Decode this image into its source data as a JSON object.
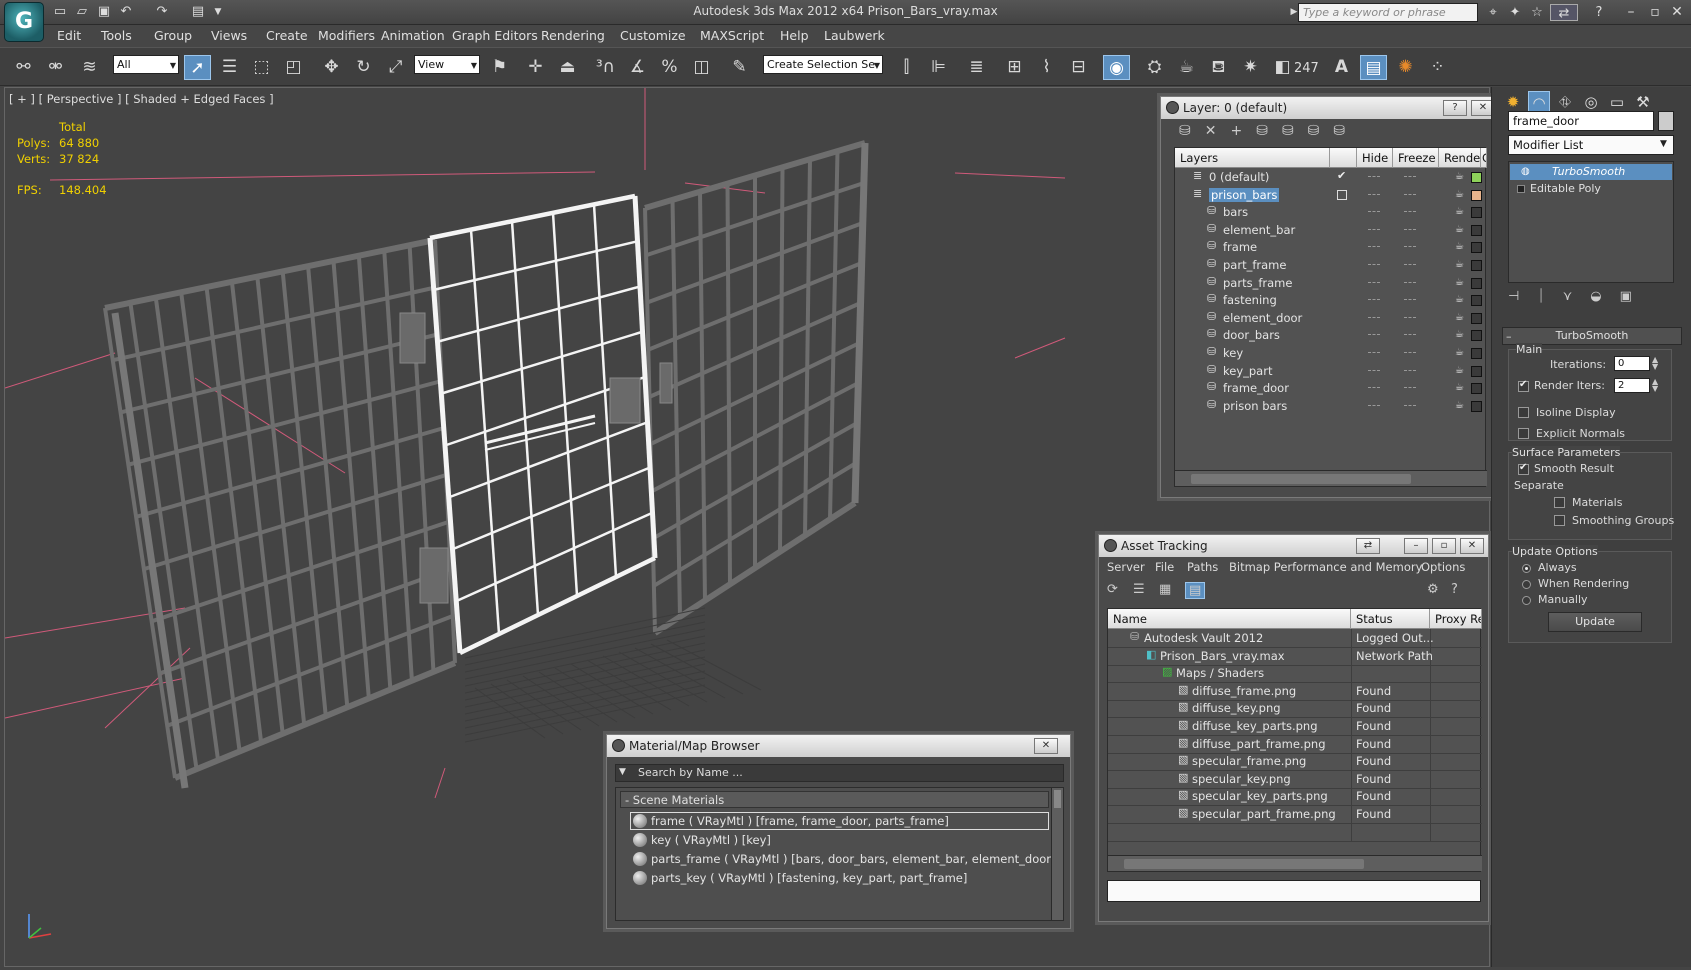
{
  "window": {
    "title": "Autodesk 3ds Max  2012 x64      Prison_Bars_vray.max",
    "search_placeholder": "Type a keyword or phrase"
  },
  "menu": [
    "Edit",
    "Tools",
    "Group",
    "Views",
    "Create",
    "Modifiers",
    "Animation",
    "Graph Editors",
    "Rendering",
    "Customize",
    "MAXScript",
    "Help",
    "Laubwerk"
  ],
  "toolbar": {
    "selection_filter": "All",
    "ref_coord": "View",
    "named_selection": "Create Selection Se",
    "counter": "247"
  },
  "viewport": {
    "label": "[ + ] [ Perspective ] [ Shaded + Edged Faces ]",
    "stats": {
      "total_label": "Total",
      "polys_label": "Polys:",
      "polys_value": "64 880",
      "verts_label": "Verts:",
      "verts_value": "37 824",
      "fps_label": "FPS:",
      "fps_value": "148.404"
    }
  },
  "layer_window": {
    "title": "Layer: 0 (default)",
    "columns": [
      "Layers",
      "Hide",
      "Freeze",
      "Render",
      "Color"
    ],
    "rows": [
      {
        "name": "0 (default)",
        "color": "#8ed25a",
        "level": 0,
        "active": true
      },
      {
        "name": "prison_bars",
        "color": "#e8b48c",
        "level": 0,
        "selected": true
      },
      {
        "name": "bars",
        "color": "#3a3a3a",
        "level": 1
      },
      {
        "name": "element_bar",
        "color": "#3a3a3a",
        "level": 1
      },
      {
        "name": "frame",
        "color": "#3a3a3a",
        "level": 1
      },
      {
        "name": "part_frame",
        "color": "#3a3a3a",
        "level": 1
      },
      {
        "name": "parts_frame",
        "color": "#3a3a3a",
        "level": 1
      },
      {
        "name": "fastening",
        "color": "#3a3a3a",
        "level": 1
      },
      {
        "name": "element_door",
        "color": "#3a3a3a",
        "level": 1
      },
      {
        "name": "door_bars",
        "color": "#3a3a3a",
        "level": 1
      },
      {
        "name": "key",
        "color": "#3a3a3a",
        "level": 1
      },
      {
        "name": "key_part",
        "color": "#3a3a3a",
        "level": 1
      },
      {
        "name": "frame_door",
        "color": "#3a3a3a",
        "level": 1
      },
      {
        "name": "prison bars",
        "color": "#3a3a3a",
        "level": 1
      }
    ]
  },
  "asset_window": {
    "title": "Asset Tracking",
    "menu": [
      "Server",
      "File",
      "Paths",
      "Bitmap Performance and Memory",
      "Options"
    ],
    "columns": [
      "Name",
      "Status",
      "Proxy Res"
    ],
    "rows": [
      {
        "name": "Autodesk Vault 2012",
        "status": "Logged Out...",
        "level": 0
      },
      {
        "name": "Prison_Bars_vray.max",
        "status": "Network Path",
        "level": 1
      },
      {
        "name": "Maps / Shaders",
        "status": "",
        "level": 2
      },
      {
        "name": "diffuse_frame.png",
        "status": "Found",
        "level": 3
      },
      {
        "name": "diffuse_key.png",
        "status": "Found",
        "level": 3
      },
      {
        "name": "diffuse_key_parts.png",
        "status": "Found",
        "level": 3
      },
      {
        "name": "diffuse_part_frame.png",
        "status": "Found",
        "level": 3
      },
      {
        "name": "specular_frame.png",
        "status": "Found",
        "level": 3
      },
      {
        "name": "specular_key.png",
        "status": "Found",
        "level": 3
      },
      {
        "name": "specular_key_parts.png",
        "status": "Found",
        "level": 3
      },
      {
        "name": "specular_part_frame.png",
        "status": "Found",
        "level": 3
      }
    ]
  },
  "material_window": {
    "title": "Material/Map Browser",
    "search_placeholder": "Search by Name ...",
    "section": "- Scene Materials",
    "items": [
      "frame  ( VRayMtl )  [frame, frame_door, parts_frame]",
      "key  ( VRayMtl )  [key]",
      "parts_frame  ( VRayMtl )  [bars, door_bars, element_bar, element_door]",
      "parts_key  ( VRayMtl )  [fastening, key_part, part_frame]"
    ]
  },
  "command_panel": {
    "object_name": "frame_door",
    "modifier_list": "Modifier List",
    "stack": [
      "TurboSmooth",
      "Editable Poly"
    ],
    "rollout_title": "TurboSmooth",
    "main_label": "Main",
    "iterations_label": "Iterations:",
    "iterations_value": "0",
    "render_iters_label": "Render Iters:",
    "render_iters_value": "2",
    "isoline_label": "Isoline Display",
    "explicit_label": "Explicit Normals",
    "surface_label": "Surface Parameters",
    "smooth_label": "Smooth Result",
    "separate_label": "Separate",
    "materials_label": "Materials",
    "smoothing_label": "Smoothing Groups",
    "update_options_label": "Update Options",
    "always_label": "Always",
    "when_rendering_label": "When Rendering",
    "manually_label": "Manually",
    "update_button": "Update"
  }
}
